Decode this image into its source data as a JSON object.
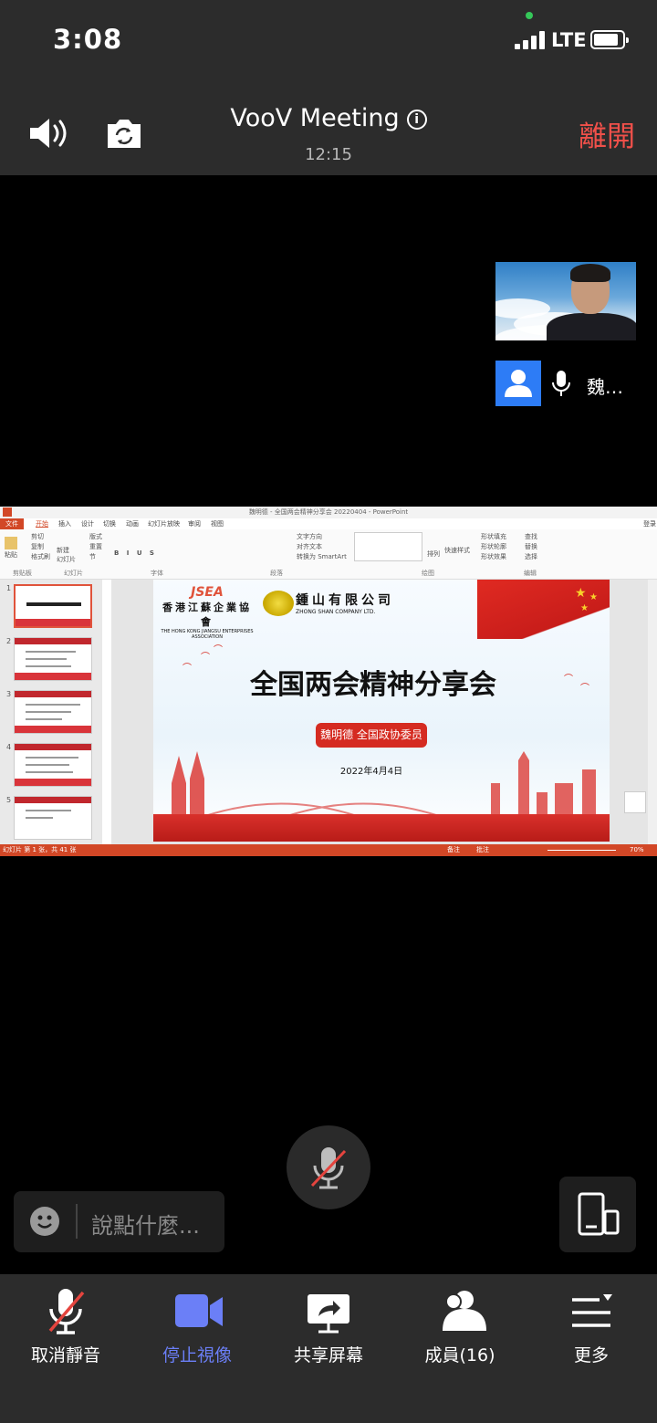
{
  "status_bar": {
    "time": "3:08",
    "network": "LTE"
  },
  "header": {
    "title": "VooV Meeting",
    "duration": "12:15",
    "leave_label": "離開"
  },
  "participants": [
    {
      "name": "魏…"
    }
  ],
  "shared_screen": {
    "app_title": "魏明德 - 全国两会精神分享会 20220404 - PowerPoint",
    "menu_tabs": [
      "文件",
      "开始",
      "插入",
      "设计",
      "切换",
      "动画",
      "幻灯片放映",
      "审阅",
      "视图"
    ],
    "login": "登录",
    "ribbon": {
      "clipboard": [
        "剪切",
        "复制",
        "格式刷"
      ],
      "paste": "粘贴",
      "new_slide": "新建\n幻灯片",
      "layout": [
        "版式",
        "重置",
        "节"
      ],
      "para_tools": [
        "文字方向",
        "对齐文本",
        "转换为 SmartArt"
      ],
      "shape_tools": [
        "形状填充",
        "形状轮廓",
        "形状效果"
      ],
      "arrange": "排列",
      "quick_styles": "快速样式",
      "editing": [
        "查找",
        "替换",
        "选择"
      ],
      "groups": [
        "剪贴板",
        "幻灯片",
        "字体",
        "段落",
        "绘图",
        "编辑"
      ]
    },
    "thumbnails": [
      "1",
      "2",
      "3",
      "4",
      "5"
    ],
    "slide": {
      "org1_logo": "JSEA",
      "org1_cn": "香港江蘇企業協會",
      "org1_en": "THE HONG KONG JIANGSU ENTERPRISES ASSOCIATION",
      "org2_cn": "鍾山有限公司",
      "org2_en": "ZHONG SHAN COMPANY LTD.",
      "title": "全国两会精神分享会",
      "presenter": "魏明德 全国政协委员",
      "date": "2022年4月4日"
    },
    "status": {
      "slide_info": "幻灯片 第 1 张，共 41 张",
      "notes": "备注",
      "comments": "批注",
      "zoom": "70%"
    }
  },
  "chat": {
    "placeholder": "說點什麼..."
  },
  "toolbar": {
    "unmute": "取消靜音",
    "stop_video": "停止視像",
    "share_screen": "共享屏幕",
    "members": "成員(16)",
    "more": "更多"
  },
  "colors": {
    "leave": "#f0504a",
    "video_active": "#6b7ff7",
    "avatar": "#2d7cf6",
    "ppt_accent": "#d24726"
  }
}
